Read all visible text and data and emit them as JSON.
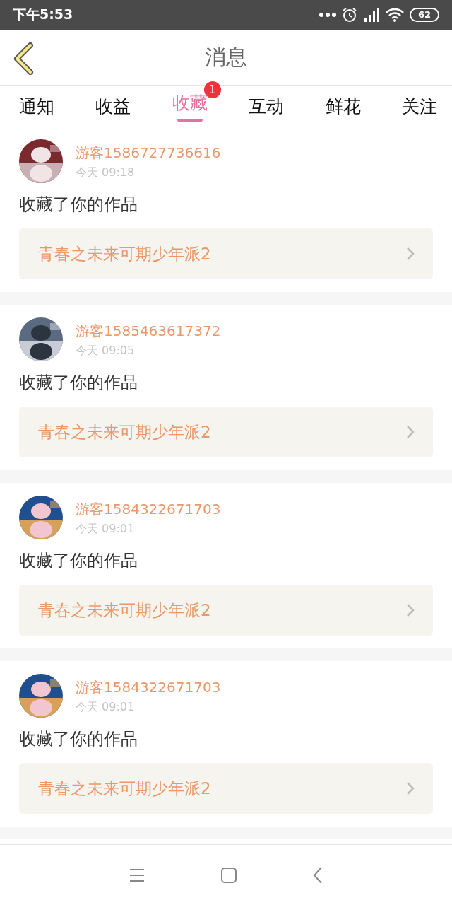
{
  "status_bar": {
    "time": "下午5:53",
    "battery": "62"
  },
  "header": {
    "title": "消息"
  },
  "tabs": [
    {
      "label": "通知",
      "selected": false
    },
    {
      "label": "收益",
      "selected": false
    },
    {
      "label": "收藏",
      "selected": true,
      "badge": "1"
    },
    {
      "label": "互动",
      "selected": false
    },
    {
      "label": "鲜花",
      "selected": false
    },
    {
      "label": "关注",
      "selected": false
    }
  ],
  "messages": [
    {
      "user": "游客1586727736616",
      "time": "今天 09:18",
      "action": "收藏了你的作品",
      "work": "青春之未来可期少年派2"
    },
    {
      "user": "游客1585463617372",
      "time": "今天 09:05",
      "action": "收藏了你的作品",
      "work": "青春之未来可期少年派2"
    },
    {
      "user": "游客1584322671703",
      "time": "今天 09:01",
      "action": "收藏了你的作品",
      "work": "青春之未来可期少年派2"
    },
    {
      "user": "游客1584322671703",
      "time": "今天 09:01",
      "action": "收藏了你的作品",
      "work": "青春之未来可期少年派2"
    }
  ]
}
